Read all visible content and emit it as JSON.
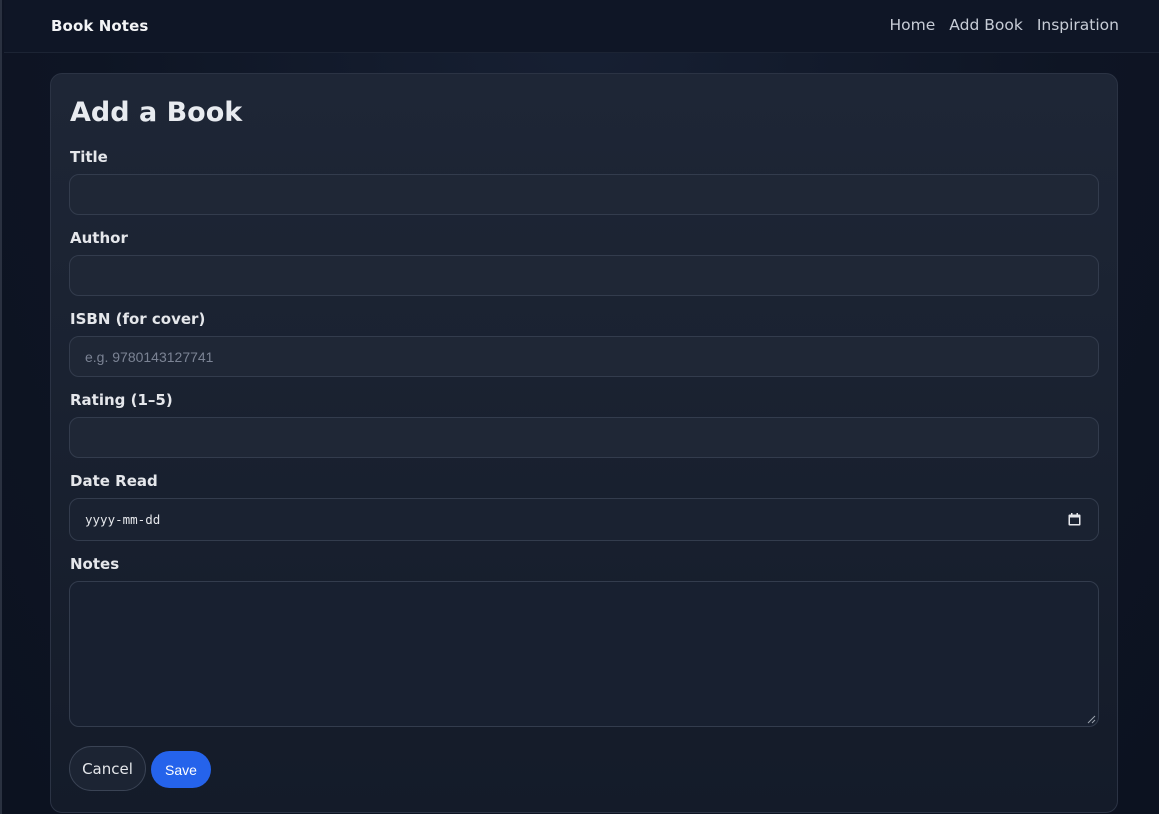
{
  "navbar": {
    "brand": "Book Notes",
    "links": [
      "Home",
      "Add Book",
      "Inspiration"
    ]
  },
  "form": {
    "title": "Add a Book",
    "fields": {
      "title": {
        "label": "Title",
        "value": "",
        "placeholder": ""
      },
      "author": {
        "label": "Author",
        "value": "",
        "placeholder": ""
      },
      "isbn": {
        "label": "ISBN (for cover)",
        "value": "",
        "placeholder": "e.g. 9780143127741"
      },
      "rating": {
        "label": "Rating (1–5)",
        "value": "",
        "placeholder": ""
      },
      "date_read": {
        "label": "Date Read",
        "value": "yyyy-mm-dd",
        "icon": "calendar-icon"
      },
      "notes": {
        "label": "Notes",
        "value": ""
      }
    },
    "buttons": {
      "cancel": "Cancel",
      "save": "Save"
    }
  },
  "colors": {
    "accent": "#2563eb",
    "background": "#0f1625",
    "card": "#1e2636"
  }
}
